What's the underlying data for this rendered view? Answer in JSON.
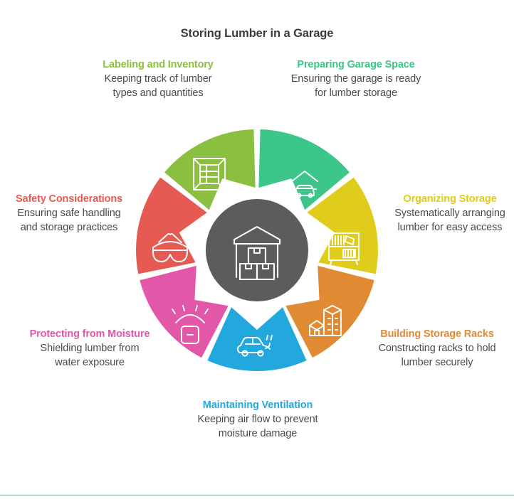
{
  "title": "Storing Lumber in a Garage",
  "center": {
    "icon": "warehouse-boxes-icon",
    "color": "#5c5c5c"
  },
  "background": "#ffffff",
  "rule_color": "#7f9a8a",
  "chart_data": {
    "type": "pie",
    "title": "Storing Lumber in a Garage",
    "subtype": "donut-segmented-wheel",
    "segment_count": 7,
    "equal_segments": true,
    "segment_degrees": 51.4286,
    "categories": [
      "Preparing Garage Space",
      "Organizing Storage",
      "Building Storage Racks",
      "Maintaining Ventilation",
      "Protecting from Moisture",
      "Safety Considerations",
      "Labeling and Inventory"
    ],
    "values": [
      14.29,
      14.29,
      14.29,
      14.29,
      14.29,
      14.29,
      14.29
    ],
    "colors": [
      "#3CC68A",
      "#DFCC1B",
      "#E08A33",
      "#22A8DC",
      "#E257A8",
      "#E55B54",
      "#8BBF40"
    ],
    "legend": "labels-around-wheel",
    "xlabel": "",
    "ylabel": ""
  },
  "segments": [
    {
      "index": 0,
      "title": "Preparing Garage Space",
      "desc": "Ensuring the garage is ready for lumber storage",
      "color": "#3CC68A",
      "icon": "garage-car-icon"
    },
    {
      "index": 1,
      "title": "Organizing Storage",
      "desc": "Systematically arranging lumber for easy access",
      "color": "#DFCC1B",
      "icon": "shelving-unit-icon"
    },
    {
      "index": 2,
      "title": "Building Storage Racks",
      "desc": "Constructing racks to hold lumber securely",
      "color": "#E08A33",
      "icon": "buildings-icon"
    },
    {
      "index": 3,
      "title": "Maintaining Ventilation",
      "desc": "Keeping air flow to prevent moisture damage",
      "color": "#22A8DC",
      "icon": "car-exhaust-icon"
    },
    {
      "index": 4,
      "title": "Protecting from Moisture",
      "desc": "Shielding lumber from water exposure",
      "color": "#E257A8",
      "icon": "box-rain-cover-icon"
    },
    {
      "index": 5,
      "title": "Safety Considerations",
      "desc": "Ensuring safe handling and storage practices",
      "color": "#E55B54",
      "icon": "safety-goggles-icon"
    },
    {
      "index": 6,
      "title": "Labeling and Inventory",
      "desc": "Keeping track of lumber types and quantities",
      "color": "#8BBF40",
      "icon": "labeled-crate-icon"
    }
  ]
}
